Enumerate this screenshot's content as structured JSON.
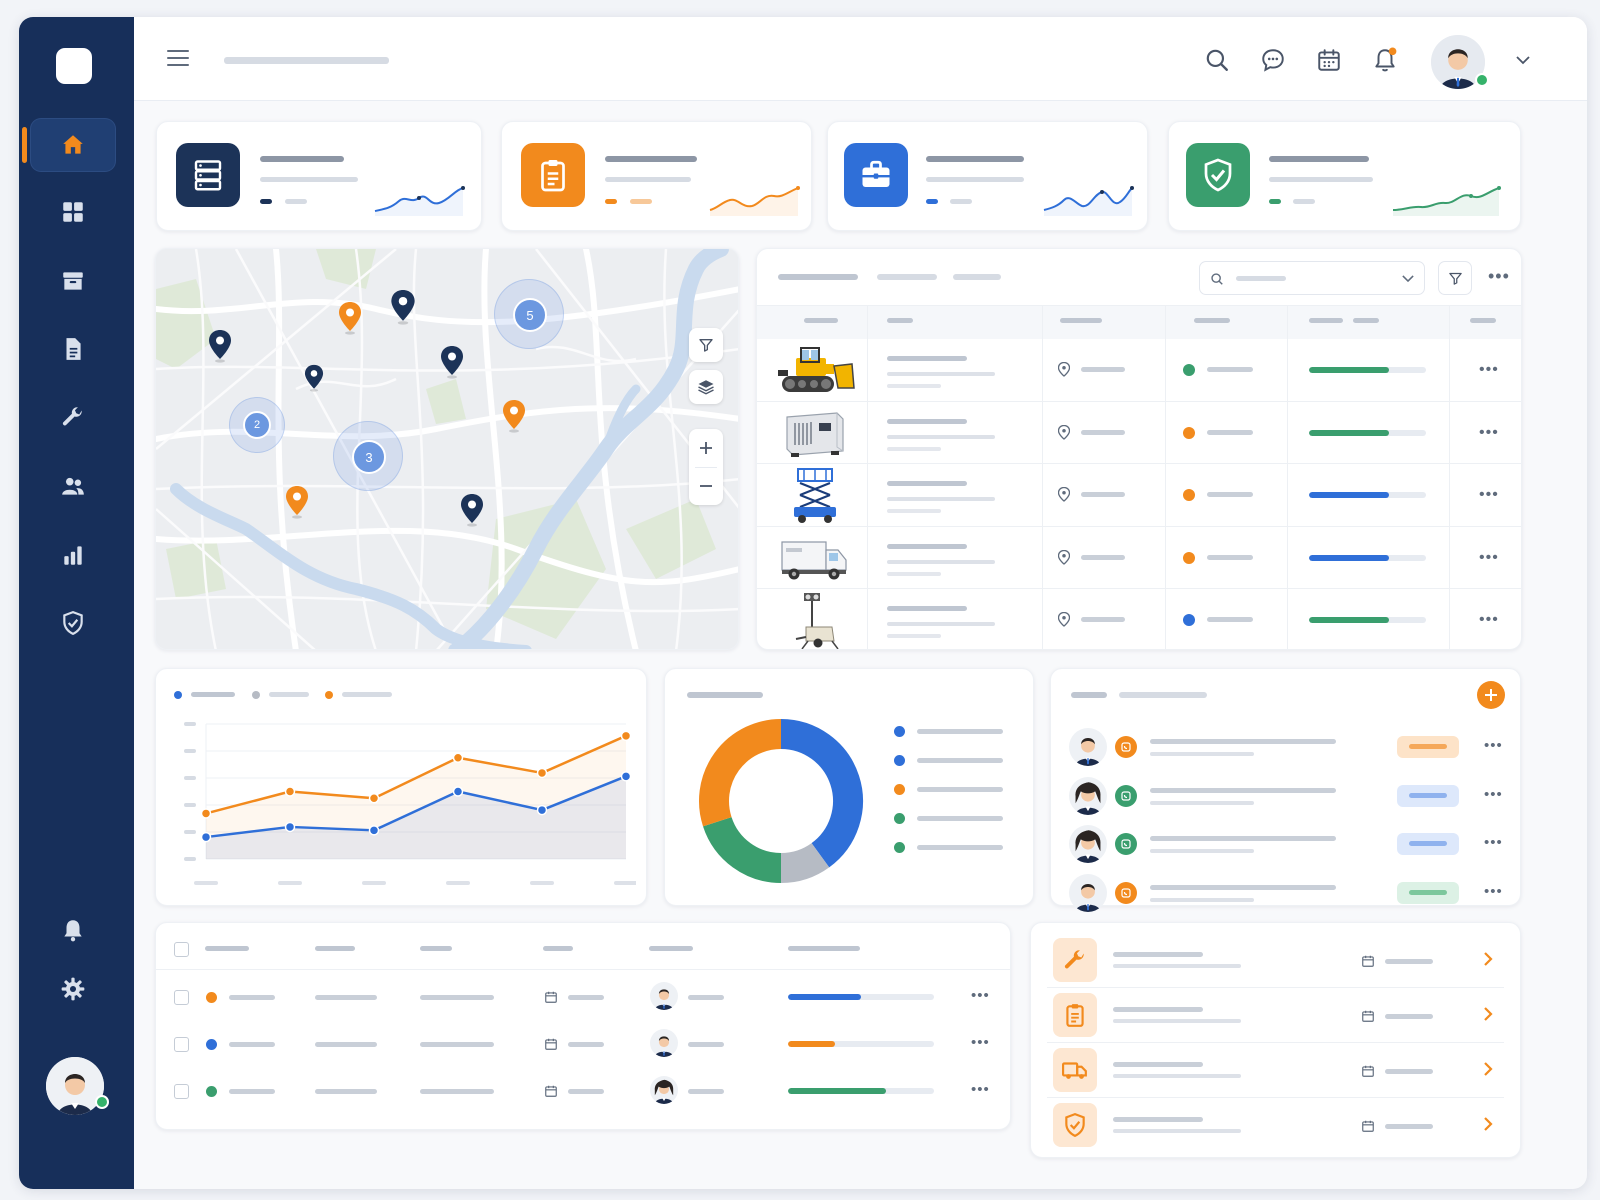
{
  "colors": {
    "sidebar": "#172f5a",
    "accent_orange": "#f28a1d",
    "accent_blue": "#2f6fd8",
    "accent_green": "#3a9e6e",
    "navy": "#1c3358"
  },
  "sidebar": {
    "items": [
      {
        "icon": "home-icon",
        "active": true
      },
      {
        "icon": "grid-icon"
      },
      {
        "icon": "archive-box-icon"
      },
      {
        "icon": "document-icon"
      },
      {
        "icon": "wrench-icon"
      },
      {
        "icon": "users-icon"
      },
      {
        "icon": "bar-chart-icon"
      },
      {
        "icon": "shield-check-icon"
      }
    ],
    "bottom_items": [
      {
        "icon": "bell-icon"
      },
      {
        "icon": "gear-icon"
      }
    ]
  },
  "topbar": {
    "icons": [
      "search-icon",
      "chat-icon",
      "calendar-icon",
      "bell-icon"
    ],
    "notification_badge": true
  },
  "stat_cards": [
    {
      "icon": "server-icon",
      "color": "#1c3358",
      "trend_color": "#2f6fd8"
    },
    {
      "icon": "clipboard-icon",
      "color": "#f28a1d",
      "trend_color": "#f28a1d"
    },
    {
      "icon": "briefcase-icon",
      "color": "#2f6fd8",
      "trend_color": "#2f6fd8"
    },
    {
      "icon": "shield-check-icon",
      "color": "#3a9e6e",
      "trend_color": "#3a9e6e"
    }
  ],
  "map": {
    "cluster_labels": [
      "5",
      "2",
      "3"
    ],
    "controls": [
      "filter-icon",
      "layers-icon",
      "zoom-in-icon",
      "zoom-out-icon"
    ]
  },
  "equipment_table": {
    "rows": [
      {
        "image": "bulldozer-icon",
        "status_color": "#3a9e6e",
        "progress": 0.68,
        "progress_color": "#3a9e6e"
      },
      {
        "image": "generator-icon",
        "status_color": "#f28a1d",
        "progress": 0.68,
        "progress_color": "#3a9e6e"
      },
      {
        "image": "scissor-lift-icon",
        "status_color": "#f28a1d",
        "progress": 0.68,
        "progress_color": "#2f6fd8"
      },
      {
        "image": "truck-icon",
        "status_color": "#f28a1d",
        "progress": 0.68,
        "progress_color": "#2f6fd8"
      },
      {
        "image": "light-tower-icon",
        "status_color": "#2f6fd8",
        "progress": 0.68,
        "progress_color": "#3a9e6e"
      }
    ]
  },
  "chart_data": [
    {
      "type": "line",
      "x": [
        1,
        2,
        3,
        4,
        5,
        6
      ],
      "series": [
        {
          "values": [
            2.7,
            4.0,
            3.6,
            6.0,
            5.1,
            7.3
          ],
          "color": "#f28a1d"
        },
        {
          "values": [
            1.3,
            1.9,
            1.7,
            4.0,
            2.9,
            4.9
          ],
          "color": "#2f6fd8"
        }
      ],
      "ylim": [
        0,
        8
      ],
      "grid": true,
      "legend": "top-left"
    },
    {
      "type": "pie",
      "donut": true,
      "values": [
        40,
        10,
        20,
        30
      ],
      "colors": [
        "#2f6fd8",
        "#b6bbc4",
        "#3a9e6e",
        "#f28a1d"
      ],
      "legend": "right"
    }
  ],
  "donut_legend_colors": [
    "#2f6fd8",
    "#2f6fd8",
    "#f28a1d",
    "#3a9e6e",
    "#3a9e6e"
  ],
  "people_list": [
    {
      "badge_color": "#f28a1d",
      "badge_icon": "phone-icon",
      "pill_color": "#fde3c8",
      "pill_bar": "#f5a85a",
      "gender": "m"
    },
    {
      "badge_color": "#3a9e6e",
      "badge_icon": "phone-icon",
      "pill_color": "#dde8fb",
      "pill_bar": "#8fb2ee",
      "gender": "f"
    },
    {
      "badge_color": "#3a9e6e",
      "badge_icon": "phone-icon",
      "pill_color": "#dde8fb",
      "pill_bar": "#8fb2ee",
      "gender": "f"
    },
    {
      "badge_color": "#f28a1d",
      "badge_icon": "phone-icon",
      "pill_color": "#dcf1e5",
      "pill_bar": "#7cc79c",
      "gender": "m"
    }
  ],
  "work_orders": [
    {
      "dot": "#f28a1d",
      "progress": 0.5,
      "color": "#2f6fd8",
      "gender": "m"
    },
    {
      "dot": "#2f6fd8",
      "progress": 0.32,
      "color": "#f28a1d",
      "gender": "m"
    },
    {
      "dot": "#3a9e6e",
      "progress": 0.67,
      "color": "#3a9e6e",
      "gender": "f"
    }
  ],
  "tasks": [
    {
      "icon": "wrench-icon"
    },
    {
      "icon": "clipboard-icon"
    },
    {
      "icon": "truck-icon"
    },
    {
      "icon": "shield-icon"
    }
  ]
}
